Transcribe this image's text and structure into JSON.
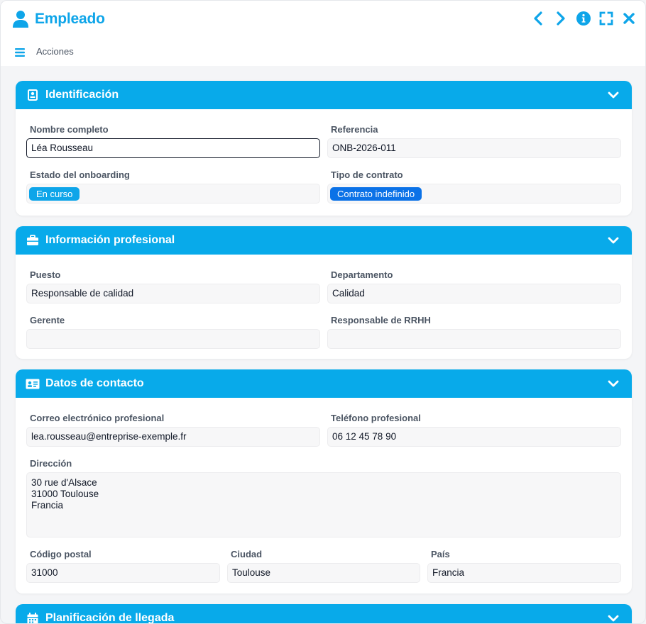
{
  "header": {
    "title": "Empleado",
    "actions_label": "Acciones"
  },
  "colors": {
    "accent": "#08aaea",
    "badge_status": "#0ea5e9",
    "badge_contract": "#0b72e7"
  },
  "sections": {
    "identification": {
      "title": "Identificación",
      "full_name_label": "Nombre completo",
      "full_name_value": "Léa Rousseau",
      "reference_label": "Referencia",
      "reference_value": "ONB-2026-011",
      "status_label": "Estado del onboarding",
      "status_value": "En curso",
      "contract_label": "Tipo de contrato",
      "contract_value": "Contrato indefinido"
    },
    "professional": {
      "title": "Información profesional",
      "position_label": "Puesto",
      "position_value": "Responsable de calidad",
      "department_label": "Departamento",
      "department_value": "Calidad",
      "manager_label": "Gerente",
      "manager_value": "",
      "hr_label": "Responsable de RRHH",
      "hr_value": ""
    },
    "contact": {
      "title": "Datos de contacto",
      "email_label": "Correo electrónico profesional",
      "email_value": "lea.rousseau@entreprise-exemple.fr",
      "phone_label": "Teléfono profesional",
      "phone_value": "06 12 45 78 90",
      "address_label": "Dirección",
      "address_value": "30 rue d'Alsace\n31000 Toulouse\nFrancia",
      "postal_label": "Código postal",
      "postal_value": "31000",
      "city_label": "Ciudad",
      "city_value": "Toulouse",
      "country_label": "País",
      "country_value": "Francia"
    },
    "arrival": {
      "title": "Planificación de llegada"
    }
  }
}
